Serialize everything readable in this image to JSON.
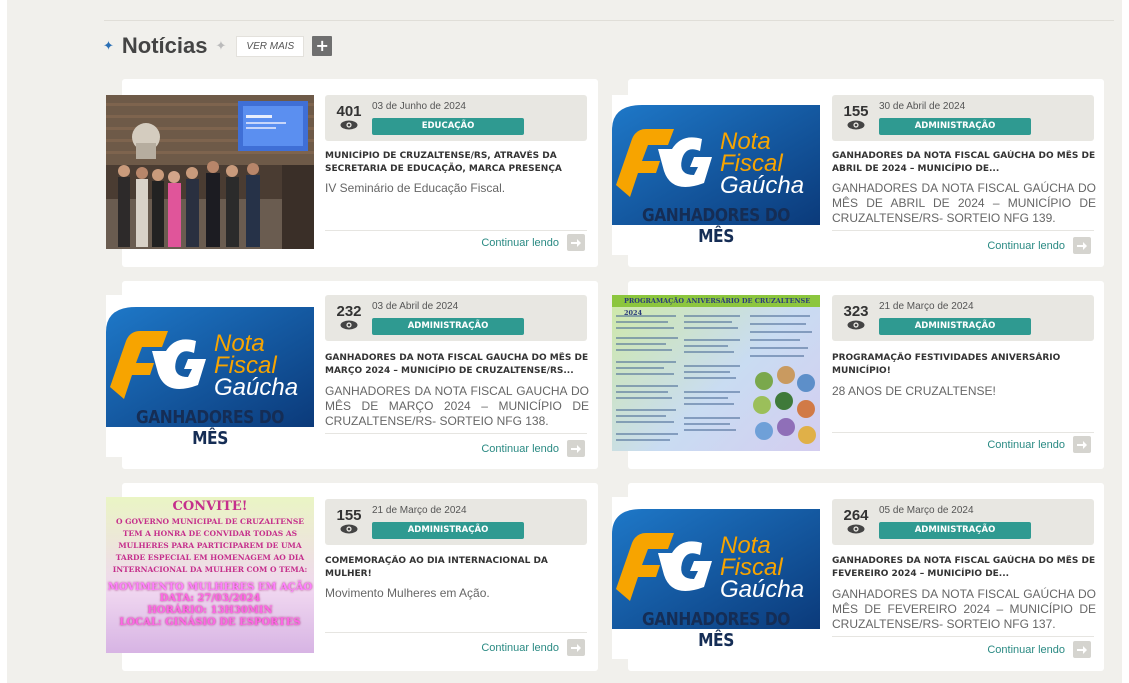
{
  "section": {
    "title": "Notícias",
    "ver_mais": "VER MAIS",
    "plus": "+"
  },
  "continue_label": "Continuar lendo",
  "colors": {
    "accent_teal": "#2f9a91",
    "link_teal": "#2a8a83",
    "star_blue": "#2a6fb5",
    "nfg_navy": "#152d55",
    "nfg_orange": "#f7a400"
  },
  "posts": [
    {
      "views": "401",
      "date": "03 de Junho de 2024",
      "category": "EDUCAÇÃO",
      "title": "MUNICÍPIO DE CRUZALTENSE/RS, ATRAVÉS DA SECRETARIA DE EDUCAÇÃO, MARCA PRESENÇA NO...",
      "excerpt": "IV Seminário de Educação Fiscal.",
      "image": "seminar-photo"
    },
    {
      "views": "155",
      "date": "30 de Abril de 2024",
      "category": "ADMINISTRAÇÃO",
      "title": "GANHADORES DA NOTA FISCAL GAÚCHA DO MÊS DE ABRIL DE 2024 – MUNICÍPIO DE...",
      "excerpt": "GANHADORES DA NOTA FISCAL GAÚCHA DO MÊS DE ABRIL DE 2024 – MUNICÍPIO DE CRUZALTENSE/RS- SORTEIO NFG 139.",
      "image": "nfg-logo"
    },
    {
      "views": "232",
      "date": "03 de Abril de 2024",
      "category": "ADMINISTRAÇÃO",
      "title": "GANHADORES DA NOTA FISCAL GAUCHA DO MÊS DE MARÇO 2024 – MUNICÍPIO DE CRUZALTENSE/RS...",
      "excerpt": "GANHADORES DA NOTA FISCAL GAUCHA DO MÊS DE MARÇO 2024 – MUNICÍPIO DE CRUZALTENSE/RS- SORTEIO NFG 138.",
      "image": "nfg-logo"
    },
    {
      "views": "323",
      "date": "21 de Março de 2024",
      "category": "ADMINISTRAÇÃO",
      "title": "PROGRAMAÇÃO FESTIVIDADES ANIVERSÁRIO MUNICÍPIO!",
      "excerpt": "28 ANOS DE CRUZALTENSE!",
      "image": "programacao-poster"
    },
    {
      "views": "155",
      "date": "21 de Março de 2024",
      "category": "ADMINISTRAÇÃO",
      "title": "COMEMORAÇÃO AO DIA INTERNACIONAL DA MULHER!",
      "excerpt": "Movimento Mulheres em Ação.",
      "image": "convite-poster"
    },
    {
      "views": "264",
      "date": "05 de Março de 2024",
      "category": "ADMINISTRAÇÃO",
      "title": "GANHADORES DA NOTA FISCAL GAÚCHA DO MÊS DE FEVEREIRO 2024 – MUNICÍPIO DE...",
      "excerpt": "GANHADORES DA NOTA FISCAL GAÚCHA DO MÊS DE FEVEREIRO 2024 – MUNICÍPIO DE CRUZALTENSE/RS- SORTEIO NFG 137.",
      "image": "nfg-logo"
    }
  ],
  "nfg": {
    "line1": "Nota",
    "line2": "Fiscal",
    "line3": "Gaúcha",
    "tagline": "GANHADORES DO MÊS"
  },
  "programacao": {
    "header": "PROGRAMAÇÃO ANIVERSÁRIO DE CRUZALTENSE 2024"
  },
  "convite": {
    "title": "CONVITE!",
    "body": "O GOVERNO MUNICIPAL DE CRUZALTENSE TEM A HONRA DE CONVIDAR TODAS AS MULHERES PARA PARTICIPAREM DE UMA TARDE ESPECIAL EM HOMENAGEM AO DIA INTERNACIONAL DA MULHER COM O TEMA:",
    "theme": "MOVIMENTO MULHERES EM AÇÃO",
    "date": "DATA: 27/03/2024",
    "time": "HORÁRIO: 13H30MIN",
    "place": "LOCAL: GINÁSIO DE ESPORTES"
  }
}
